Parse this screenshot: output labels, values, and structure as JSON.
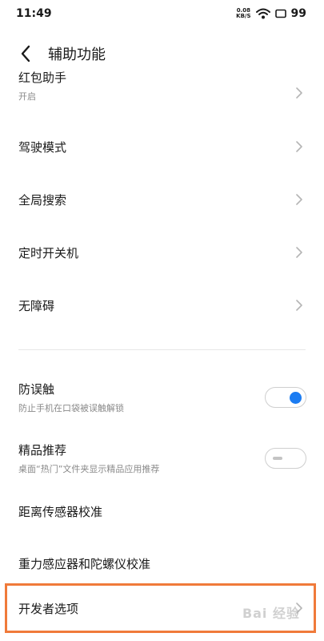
{
  "status_bar": {
    "time": "11:49",
    "net_speed_value": "0.08",
    "net_speed_unit": "KB/S",
    "battery": "99"
  },
  "header": {
    "title": "辅助功能"
  },
  "items": [
    {
      "label": "红包助手",
      "sub": "开启"
    },
    {
      "label": "驾驶模式"
    },
    {
      "label": "全局搜索"
    },
    {
      "label": "定时开关机"
    },
    {
      "label": "无障碍"
    },
    {
      "label": "防误触",
      "sub": "防止手机在口袋被误触解锁",
      "toggle": true
    },
    {
      "label": "精品推荐",
      "sub": "桌面“热门”文件夹显示精品应用推荐",
      "toggle": false
    },
    {
      "label": "距离传感器校准"
    },
    {
      "label": "重力感应器和陀螺仪校准"
    },
    {
      "label": "开发者选项"
    }
  ],
  "watermark": "Bai 经验",
  "colors": {
    "accent": "#1b7cf2",
    "highlight": "#f07a3a"
  }
}
